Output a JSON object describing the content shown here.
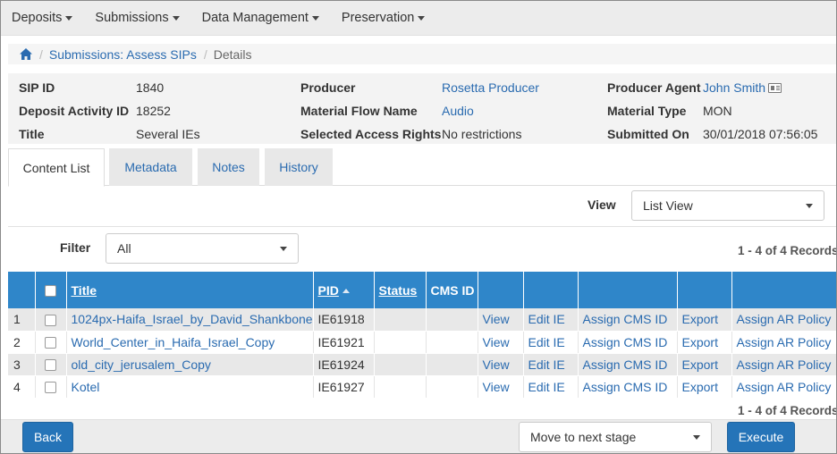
{
  "topmenu": {
    "items": [
      {
        "label": "Deposits"
      },
      {
        "label": "Submissions"
      },
      {
        "label": "Data Management"
      },
      {
        "label": "Preservation"
      }
    ]
  },
  "breadcrumb": {
    "link": "Submissions: Assess SIPs",
    "current": "Details"
  },
  "info": {
    "sip_id_label": "SIP ID",
    "sip_id": "1840",
    "deposit_activity_label": "Deposit Activity ID",
    "deposit_activity": "18252",
    "title_label": "Title",
    "title": "Several IEs",
    "producer_label": "Producer",
    "producer": "Rosetta Producer",
    "material_flow_label": "Material Flow Name",
    "material_flow": "Audio",
    "access_rights_label": "Selected Access Rights",
    "access_rights": "No restrictions",
    "producer_agent_label": "Producer Agent",
    "producer_agent": "John Smith",
    "material_type_label": "Material Type",
    "material_type": "MON",
    "submitted_on_label": "Submitted On",
    "submitted_on": "30/01/2018 07:56:05"
  },
  "tabs": [
    {
      "label": "Content List",
      "active": true
    },
    {
      "label": "Metadata"
    },
    {
      "label": "Notes"
    },
    {
      "label": "History"
    }
  ],
  "view": {
    "label": "View",
    "value": "List View"
  },
  "filter": {
    "label": "Filter",
    "value": "All"
  },
  "records_text": "1 - 4 of 4 Records",
  "table": {
    "headers": {
      "title": "Title",
      "pid": "PID",
      "status": "Status",
      "cms_id": "CMS ID"
    },
    "rows": [
      {
        "num": "1",
        "title": "1024px-Haifa_Israel_by_David_Shankbone",
        "pid": "IE61918",
        "status": "",
        "cms_id": "",
        "view": "View",
        "edit": "Edit IE",
        "assign_cms": "Assign CMS ID",
        "export": "Export",
        "assign_ar": "Assign AR Policy"
      },
      {
        "num": "2",
        "title": "World_Center_in_Haifa_Israel_Copy",
        "pid": "IE61921",
        "status": "",
        "cms_id": "",
        "view": "View",
        "edit": "Edit IE",
        "assign_cms": "Assign CMS ID",
        "export": "Export",
        "assign_ar": "Assign AR Policy"
      },
      {
        "num": "3",
        "title": "old_city_jerusalem_Copy",
        "pid": "IE61924",
        "status": "",
        "cms_id": "",
        "view": "View",
        "edit": "Edit IE",
        "assign_cms": "Assign CMS ID",
        "export": "Export",
        "assign_ar": "Assign AR Policy"
      },
      {
        "num": "4",
        "title": "Kotel",
        "pid": "IE61927",
        "status": "",
        "cms_id": "",
        "view": "View",
        "edit": "Edit IE",
        "assign_cms": "Assign CMS ID",
        "export": "Export",
        "assign_ar": "Assign AR Policy"
      }
    ]
  },
  "bottom": {
    "back_label": "Back",
    "stage_value": "Move to next stage",
    "execute_label": "Execute"
  },
  "colors": {
    "header_blue": "#2f86c9",
    "link_blue": "#2a6bb0",
    "button_blue": "#2574b8"
  }
}
